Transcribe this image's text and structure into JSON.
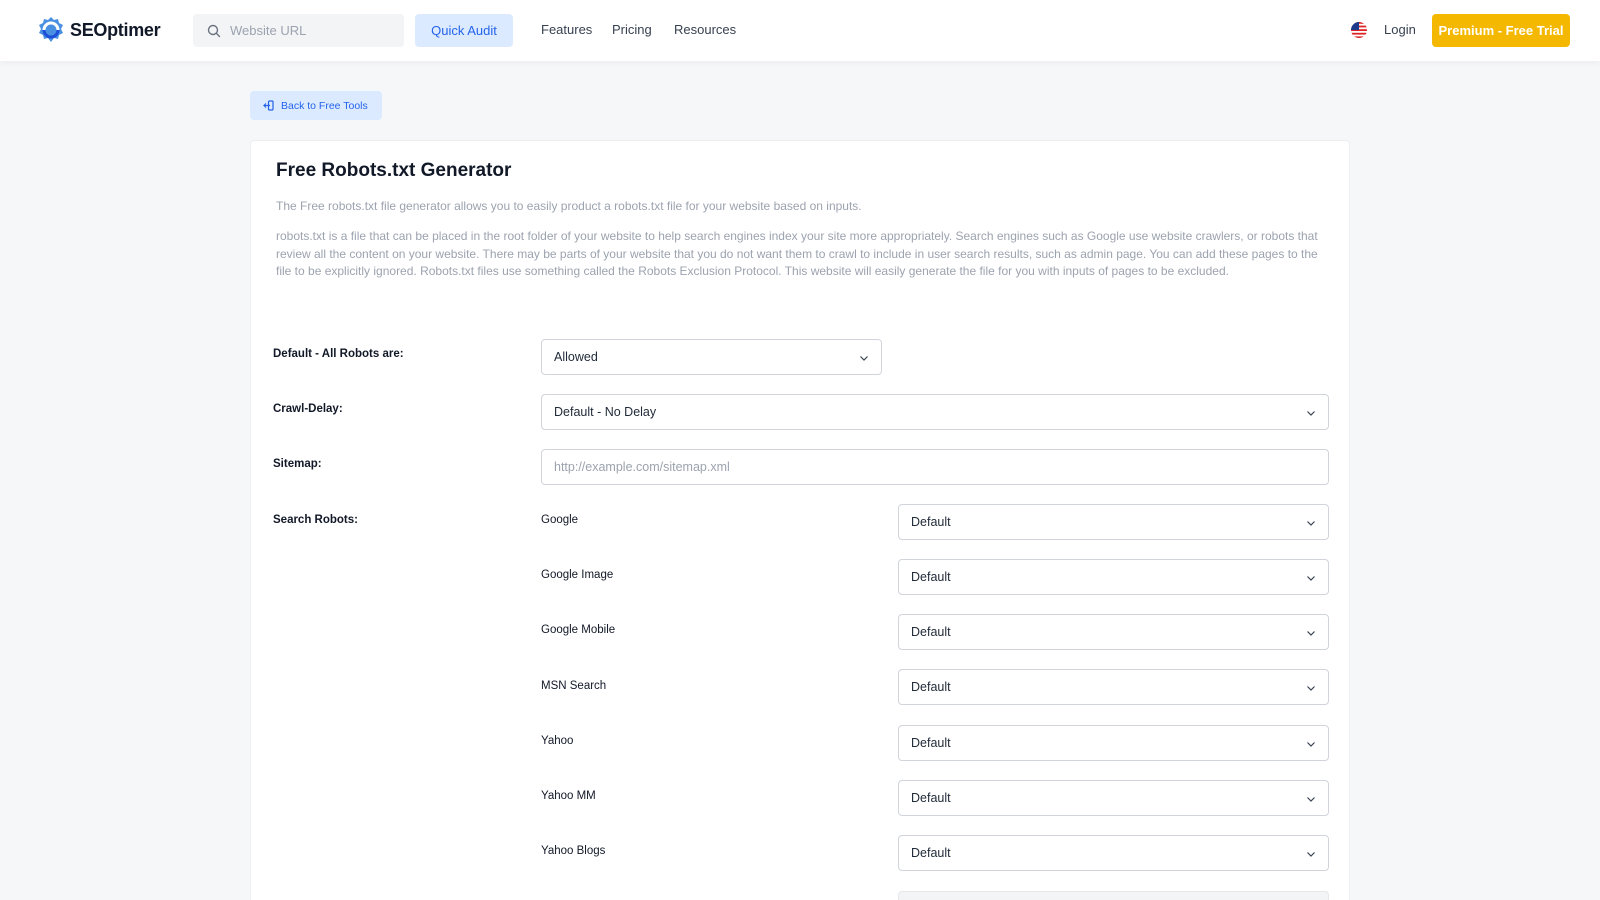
{
  "header": {
    "logo_text": "SEOptimer",
    "search_placeholder": "Website URL",
    "quick_audit": "Quick Audit",
    "nav": [
      "Features",
      "Pricing",
      "Resources"
    ],
    "login": "Login",
    "premium": "Premium - Free Trial"
  },
  "back_label": "Back to Free Tools",
  "page": {
    "title": "Free Robots.txt Generator",
    "intro": "The Free robots.txt file generator allows you to easily product a robots.txt file for your website based on inputs.",
    "description": "robots.txt is a file that can be placed in the root folder of your website to help search engines index your site more appropriately. Search engines such as Google use website crawlers, or robots that review all the content on your website. There may be parts of your website that you do not want them to crawl to include in user search results, such as admin page. You can add these pages to the file to be explicitly ignored. Robots.txt files use something called the Robots Exclusion Protocol. This website will easily generate the file for you with inputs of pages to be excluded."
  },
  "form": {
    "default_label": "Default - All Robots are:",
    "default_value": "Allowed",
    "crawl_label": "Crawl-Delay:",
    "crawl_value": "Default - No Delay",
    "sitemap_label": "Sitemap:",
    "sitemap_placeholder": "http://example.com/sitemap.xml",
    "robots_label": "Search Robots:",
    "robots": [
      {
        "name": "Google",
        "value": "Default"
      },
      {
        "name": "Google Image",
        "value": "Default"
      },
      {
        "name": "Google Mobile",
        "value": "Default"
      },
      {
        "name": "MSN Search",
        "value": "Default"
      },
      {
        "name": "Yahoo",
        "value": "Default"
      },
      {
        "name": "Yahoo MM",
        "value": "Default"
      },
      {
        "name": "Yahoo Blogs",
        "value": "Default"
      }
    ]
  },
  "colors": {
    "accent": "#2563eb",
    "accent_bg": "#dbeafe",
    "premium": "#f5b800"
  }
}
